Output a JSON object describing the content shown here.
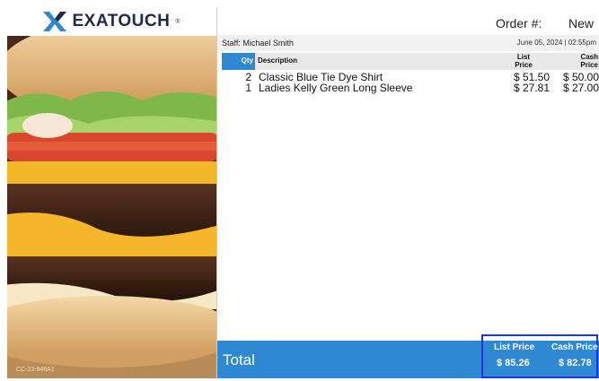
{
  "brand": {
    "logo_text": "EXATOUCH",
    "reg_mark": "®",
    "logo_color": "#1f2a44",
    "accent": "#2f88d2"
  },
  "left_panel": {
    "version_tag": "CC-23-946A1",
    "image_icon": "burger-photo"
  },
  "order": {
    "label": "Order #:",
    "value": "New"
  },
  "staff": {
    "label": "Staff:  Michael Smith",
    "datetime": "June 05, 2024  |  02:55pm"
  },
  "table": {
    "qty_header": "Qty",
    "description_header": "Description",
    "list_header_line1": "List",
    "list_header_line2": "Price",
    "cash_header_line1": "Cash",
    "cash_header_line2": "Price",
    "items": [
      {
        "qty": "2",
        "description": "Classic Blue Tie Dye Shirt",
        "list_price": "$ 51.50",
        "cash_price": "$ 50.00"
      },
      {
        "qty": "1",
        "description": "Ladies Kelly Green Long Sleeve",
        "list_price": "$ 27.81",
        "cash_price": "$ 27.00"
      }
    ]
  },
  "totals": {
    "label": "Total",
    "list_price_label": "List Price",
    "list_price_value": "$ 85.26",
    "cash_price_label": "Cash Price",
    "cash_price_value": "$ 82.78",
    "highlight_color": "#1b33e0"
  }
}
